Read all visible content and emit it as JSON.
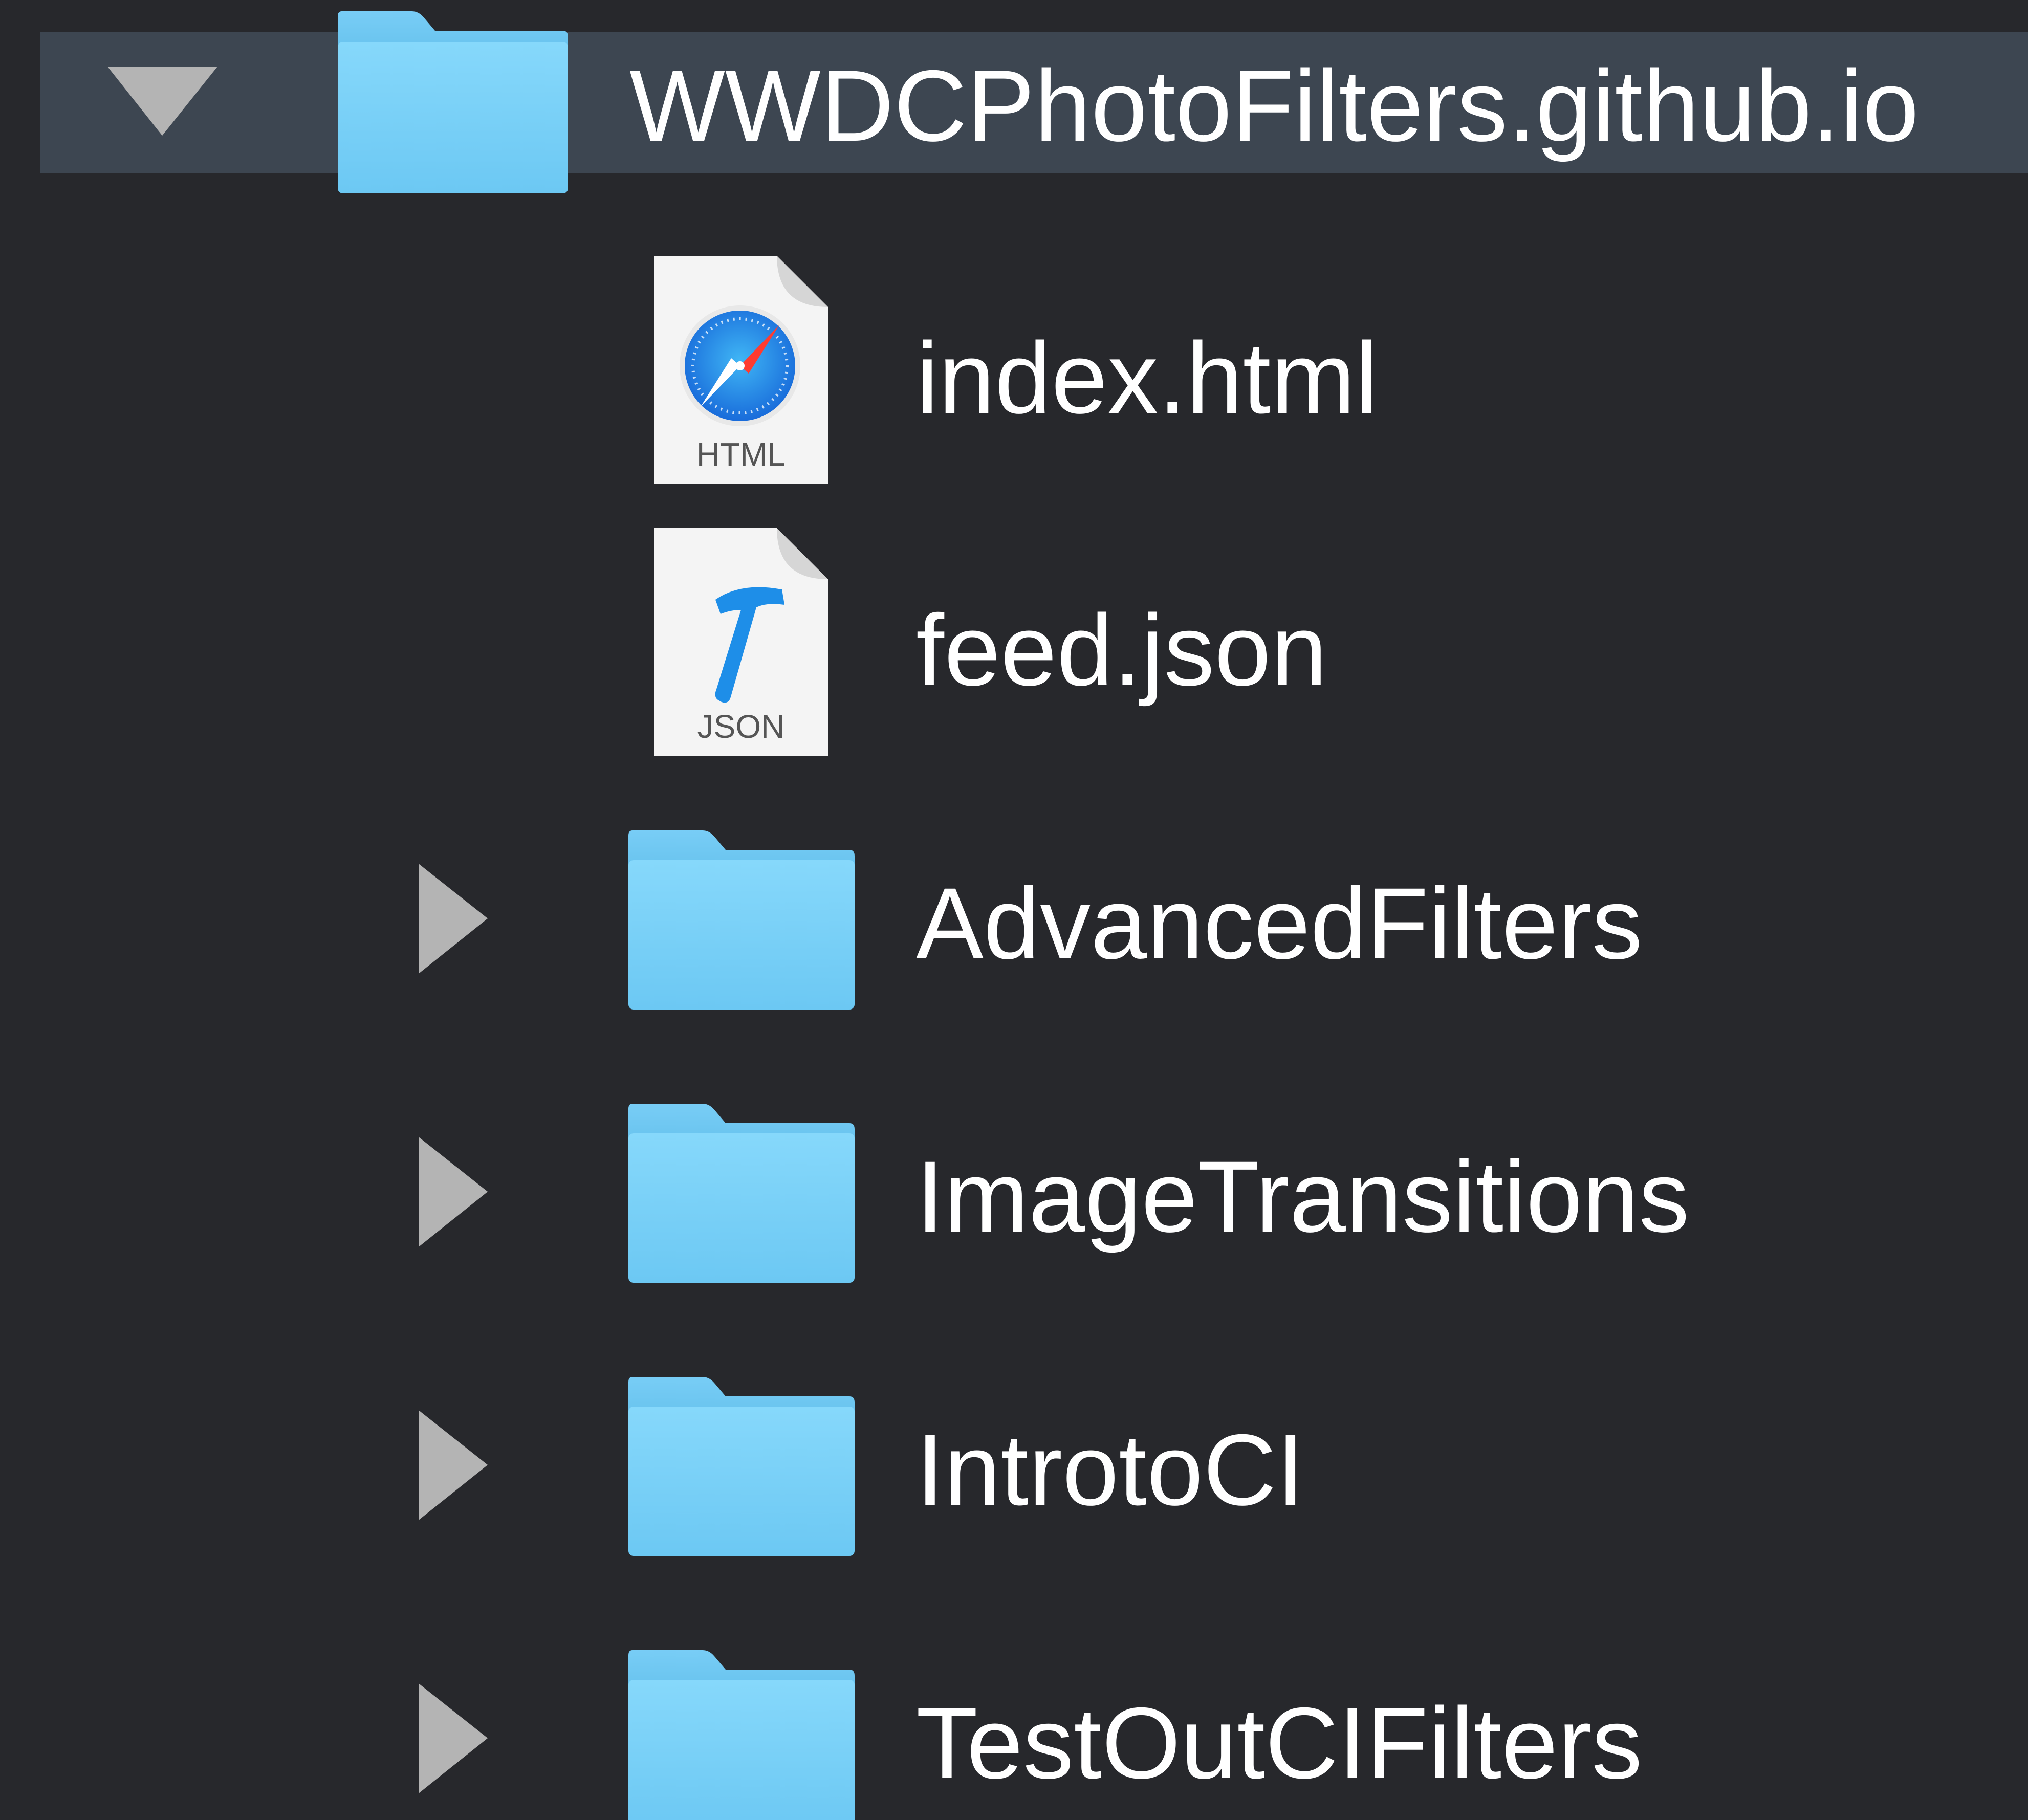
{
  "tree": {
    "root": {
      "label": "WWDCPhotoFilters.github.io",
      "expanded": true,
      "selected": true,
      "icon": "folder-icon"
    },
    "children": [
      {
        "label": "index.html",
        "kind": "file",
        "icon": "html-file-icon",
        "badge": "HTML"
      },
      {
        "label": "feed.json",
        "kind": "file",
        "icon": "json-file-icon",
        "badge": "JSON"
      },
      {
        "label": "AdvancedFilters",
        "kind": "folder",
        "icon": "folder-icon",
        "expanded": false
      },
      {
        "label": "ImageTransitions",
        "kind": "folder",
        "icon": "folder-icon",
        "expanded": false
      },
      {
        "label": "IntrotoCI",
        "kind": "folder",
        "icon": "folder-icon",
        "expanded": false
      },
      {
        "label": "TestOutCIFilters",
        "kind": "folder",
        "icon": "folder-icon",
        "expanded": false
      }
    ]
  },
  "colors": {
    "background": "#27282c",
    "selection": "#3d4651",
    "folder": "#7dd3f8",
    "text": "#ffffff",
    "disclosure": "#b4b4b4"
  }
}
